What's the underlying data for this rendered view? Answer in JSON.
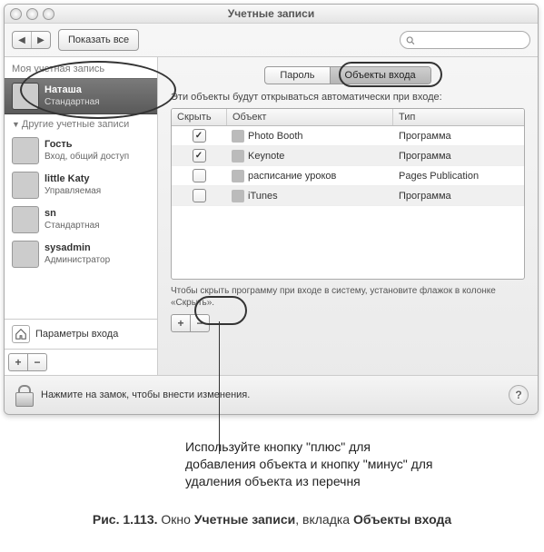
{
  "window": {
    "title": "Учетные записи",
    "show_all": "Показать все"
  },
  "sidebar": {
    "my_section": "Моя учетная запись",
    "others_section": "Другие учетные записи",
    "login_options": "Параметры входа",
    "my_account": {
      "name": "Наташа",
      "role": "Стандартная"
    },
    "accounts": [
      {
        "name": "Гость",
        "role": "Вход, общий доступ"
      },
      {
        "name": "little Katy",
        "role": "Управляемая"
      },
      {
        "name": "sn",
        "role": "Стандартная"
      },
      {
        "name": "sysadmin",
        "role": "Администратор"
      }
    ]
  },
  "main": {
    "tabs": {
      "password": "Пароль",
      "login_items": "Объекты входа"
    },
    "intro": "Эти объекты будут открываться автоматически при входе:",
    "cols": {
      "hide": "Скрыть",
      "object": "Объект",
      "type": "Тип"
    },
    "rows": [
      {
        "hide": true,
        "name": "Photo Booth",
        "type": "Программа"
      },
      {
        "hide": true,
        "name": "Keynote",
        "type": "Программа"
      },
      {
        "hide": false,
        "name": "расписание уроков",
        "type": "Pages Publication"
      },
      {
        "hide": false,
        "name": "iTunes",
        "type": "Программа"
      }
    ],
    "hint": "Чтобы скрыть программу при входе в систему, установите флажок в колонке «Скрыть»."
  },
  "lockbar": {
    "text": "Нажмите на замок, чтобы внести изменения."
  },
  "annotation": {
    "text": "Используйте кнопку \"плюс\" для добавления объекта и кнопку \"минус\" для удаления объекта из перечня"
  },
  "caption": {
    "prefix": "Рис. 1.113. ",
    "t1": "Окно ",
    "b1": "Учетные записи",
    "t2": ", вкладка ",
    "b2": "Объекты входа"
  }
}
